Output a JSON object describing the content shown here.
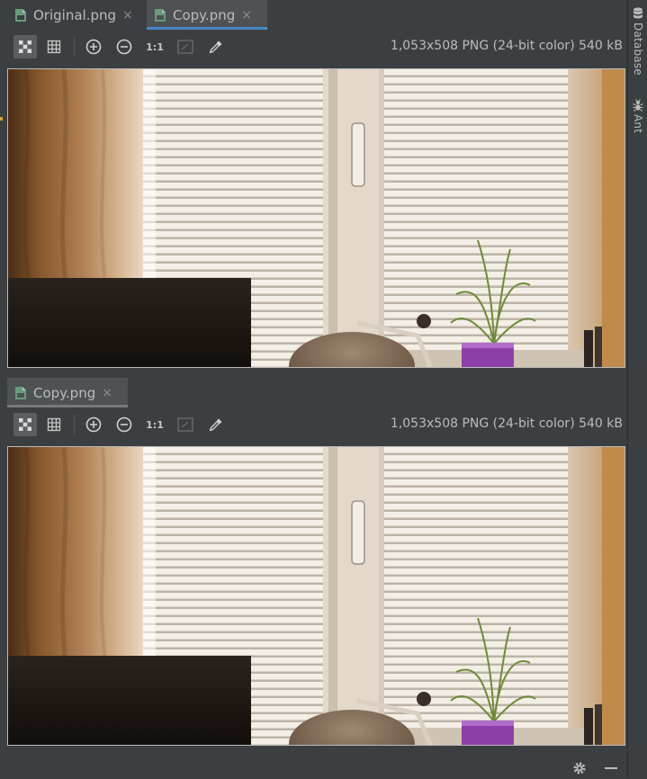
{
  "top_editor": {
    "tabs": [
      {
        "label": "Original.png",
        "close": "×",
        "active": false
      },
      {
        "label": "Copy.png",
        "close": "×",
        "active": true
      }
    ],
    "toolbar": {
      "zoom_actual_label": "1:1",
      "info": "1,053x508 PNG (24-bit color) 540 kB"
    }
  },
  "bottom_editor": {
    "tabs": [
      {
        "label": "Copy.png",
        "close": "×",
        "active": true
      }
    ],
    "toolbar": {
      "zoom_actual_label": "1:1",
      "info": "1,053x508 PNG (24-bit color) 540 kB"
    }
  },
  "right_tool_strip": {
    "items": [
      {
        "label": "Database",
        "icon": "database-icon"
      },
      {
        "label": "Ant",
        "icon": "ant-icon"
      }
    ]
  },
  "status_bar": {
    "icons": [
      "gear-icon",
      "minimize-icon"
    ]
  },
  "colors": {
    "background": "#3c3f41",
    "active_tab": "#4e5254",
    "active_tab_underline": "#4a88c7",
    "inactive_pane_underline": "#747a80",
    "left_edge_marker": "#d7a33b"
  }
}
